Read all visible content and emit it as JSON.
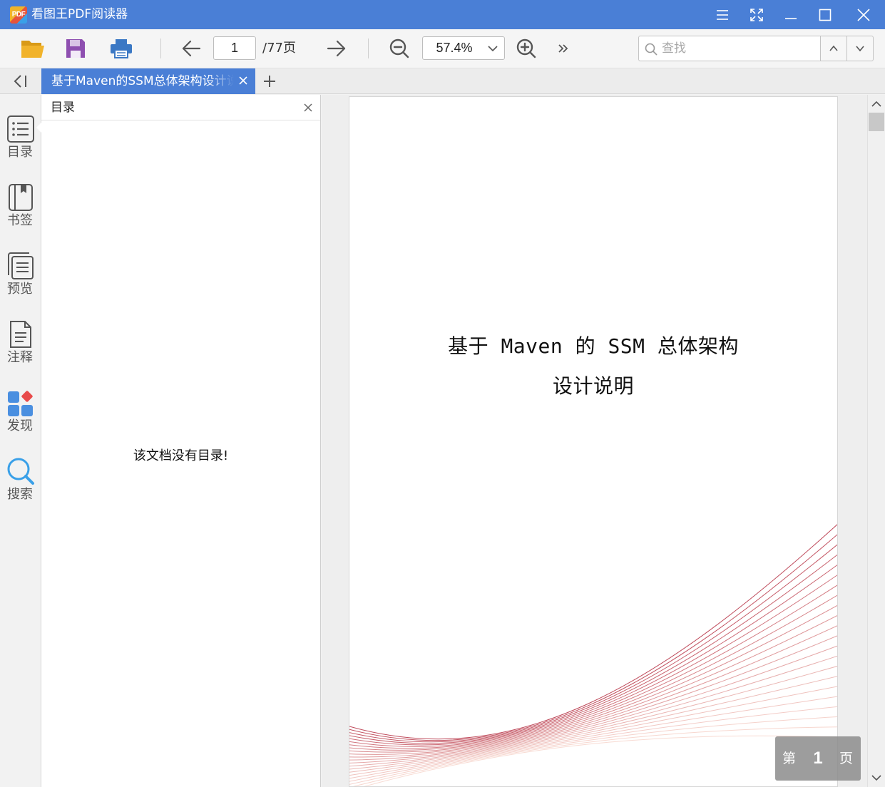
{
  "app": {
    "title": "看图王PDF阅读器",
    "logo_text": "PDF"
  },
  "window_controls": [
    {
      "name": "menu-button",
      "icon": "hamburger-icon"
    },
    {
      "name": "fullscreen-button",
      "icon": "expand-icon"
    },
    {
      "name": "minimize-button",
      "icon": "minimize-icon"
    },
    {
      "name": "maximize-button",
      "icon": "maximize-icon"
    },
    {
      "name": "close-window-button",
      "icon": "close-icon"
    }
  ],
  "toolbar": {
    "page_current": "1",
    "page_total": "/77页",
    "zoom": "57.4%",
    "search_placeholder": "查找",
    "icons": [
      "folder-open-icon",
      "save-icon",
      "print-icon",
      "arrow-left-icon",
      "arrow-right-icon",
      "zoom-out-icon",
      "zoom-in-icon",
      "more-chevrons-icon"
    ]
  },
  "tabs": [
    {
      "label": "基于Maven的SSM总体架构设计说明"
    }
  ],
  "sidebar": {
    "items": [
      {
        "label": "目录",
        "icon": "toc-list-icon"
      },
      {
        "label": "书签",
        "icon": "bookmark-icon"
      },
      {
        "label": "预览",
        "icon": "preview-pages-icon"
      },
      {
        "label": "注释",
        "icon": "annotation-icon"
      },
      {
        "label": "发现",
        "icon": "discover-icon"
      },
      {
        "label": "搜索",
        "icon": "search-icon"
      }
    ]
  },
  "toc_panel": {
    "title": "目录",
    "empty_message": "该文档没有目录!"
  },
  "document": {
    "title_line1": "基于 Maven 的 SSM 总体架构",
    "title_line2": "设计说明"
  },
  "page_indicator": {
    "prefix": "第",
    "number": "1",
    "suffix": "页"
  },
  "colors": {
    "accent": "#4a7fd6",
    "curve_dark": "#b3283c",
    "curve_light": "#f2b8a8"
  }
}
